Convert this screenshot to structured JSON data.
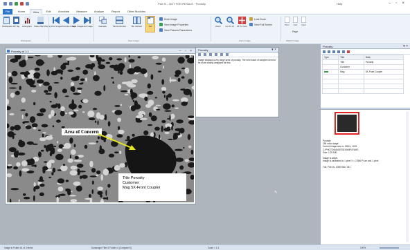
{
  "app": {
    "title": "Part III – NOT FOR RESALE · Porosity",
    "user": "Help"
  },
  "tabs": [
    {
      "label": "File"
    },
    {
      "label": "Home"
    },
    {
      "label": "View"
    },
    {
      "label": "Edit"
    },
    {
      "label": "Annotate"
    },
    {
      "label": "Measure"
    },
    {
      "label": "Analyze"
    },
    {
      "label": "Report"
    },
    {
      "label": "Other Modules"
    }
  ],
  "ribbon": {
    "buttons": [
      {
        "label": "Workspace"
      },
      {
        "label": "3D Tag"
      },
      {
        "label": "Histogram"
      },
      {
        "label": "Status Bar Display"
      },
      {
        "label": "First Image"
      },
      {
        "label": "Previous Image"
      },
      {
        "label": "Next Image"
      },
      {
        "label": "Last Image"
      },
      {
        "label": "Cascade"
      },
      {
        "label": "Tile Horizontal"
      },
      {
        "label": "Tile Vertical"
      },
      {
        "label": "Tab"
      },
      {
        "label": "Zoom"
      },
      {
        "label": "Go To 1:1"
      },
      {
        "label": "Fit To View"
      },
      {
        "label": "Prev"
      },
      {
        "label": "Curr"
      },
      {
        "label": "Next"
      },
      {
        "label": "Page"
      }
    ],
    "small_items": [
      {
        "label": "Dock Image"
      },
      {
        "label": "View Image Properties"
      },
      {
        "label": "View Pictures Parameters"
      },
      {
        "label": "Lock Zoom"
      },
      {
        "label": "View Full Screen"
      }
    ],
    "groups": [
      "Workspace",
      "View Image",
      "Zoom Image",
      "WebKit Image"
    ]
  },
  "image_window": {
    "title": "Porosity at 1:1",
    "annotation": "Area of Concern",
    "info_lines": [
      "Title  Porosity",
      "Customer",
      "Mag  5X-Front Coupler"
    ]
  },
  "note_panel": {
    "title": "Porosity",
    "text": "Image displays a very large area of porosity. The next batch of samples need to be more closely analyzed for this."
  },
  "properties_panel": {
    "title": "Porosity",
    "headers": [
      "Type",
      "Title",
      "Data"
    ],
    "rows": [
      {
        "type": "",
        "title": "Title",
        "data": "Porosity"
      },
      {
        "type": "",
        "title": "Customer",
        "data": ""
      },
      {
        "type": "",
        "title": "Mag",
        "data": "5X-Front Coupler"
      }
    ],
    "details": [
      "Porosity",
      "256 color image",
      "Current image size is: 1280 x 1024",
      "C:\\PHOTO\\IMAGES\\EXAMPLE\\IMG",
      "Size: 1.25 MB",
      "",
      "Image is active.",
      "Image is calibrated to 1 pixel X = 2.556 Pi um and 1 pixel",
      "",
      "Tue, Feb 16, 2008          Size: 261"
    ]
  },
  "status_bar": {
    "left": "Image in Folder #1 of 3 items",
    "mid": "Dustscape Title=1 Folder=4 (Compare 8)",
    "zoom_label": "Zoom = 1:1",
    "right": "100%"
  },
  "colors": {
    "file_tab": "#2b74c7",
    "ribbon_bg": "#eef3fa",
    "workspace": "#afb5bd",
    "annotation_arrow": "#e6e61a",
    "thumb_border": "#e02424"
  }
}
